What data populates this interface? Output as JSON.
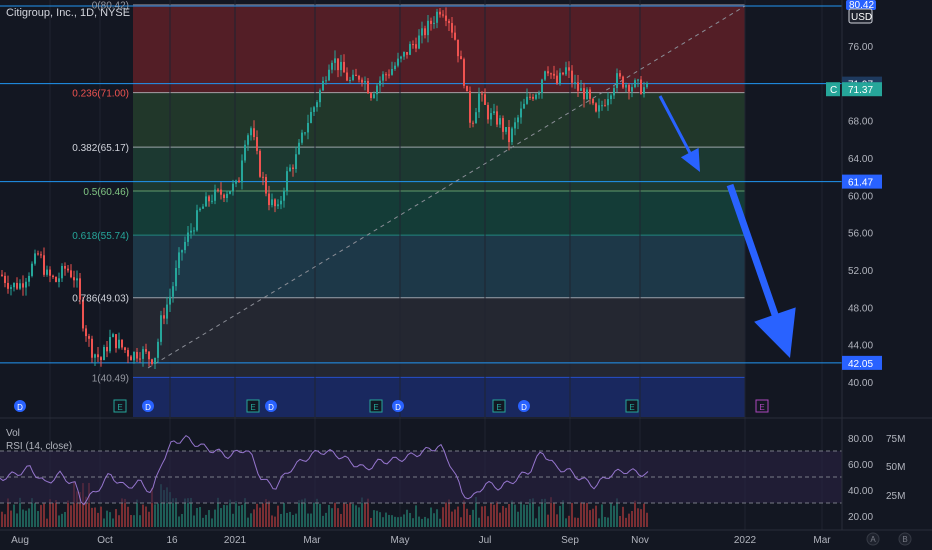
{
  "header": {
    "title": "Citigroup, Inc., 1D, NYSE"
  },
  "price_axis": {
    "currency": "USD",
    "ticks": [
      "76.00",
      "72.00",
      "68.00",
      "64.00",
      "60.00",
      "56.00",
      "52.00",
      "48.00",
      "44.00",
      "40.00"
    ]
  },
  "price_tags": [
    {
      "label": "71.97",
      "value": 71.97,
      "color": "#1e3a5f"
    },
    {
      "label": "C",
      "value": 71.37,
      "color": "#26a69a"
    },
    {
      "label": "71.37",
      "value": 71.37,
      "color": "#26a69a"
    },
    {
      "label": "61.47",
      "value": 61.47,
      "color": "#2962ff"
    },
    {
      "label": "42.05",
      "value": 42.05,
      "color": "#2962ff"
    }
  ],
  "top_tag": "80.42",
  "indicators": {
    "vol_label": "Vol",
    "rsi_label": "RSI (14, close)",
    "rsi_ticks": [
      "80.00",
      "60.00",
      "40.00",
      "20.00"
    ],
    "vol_ticks": [
      "75M",
      "50M",
      "25M"
    ]
  },
  "time_axis": {
    "labels": [
      "Aug",
      "Oct",
      "16",
      "2021",
      "Mar",
      "May",
      "Jul",
      "Sep",
      "Nov",
      "2022",
      "Mar"
    ],
    "bottom_icons": [
      "A",
      "B"
    ]
  },
  "event_markers": [
    {
      "type": "D",
      "x": 20
    },
    {
      "type": "E",
      "x": 120
    },
    {
      "type": "D",
      "x": 148
    },
    {
      "type": "E",
      "x": 253
    },
    {
      "type": "D",
      "x": 271
    },
    {
      "type": "E",
      "x": 376
    },
    {
      "type": "D",
      "x": 398
    },
    {
      "type": "E",
      "x": 499
    },
    {
      "type": "D",
      "x": 524
    },
    {
      "type": "E",
      "x": 632
    },
    {
      "type": "E",
      "x": 762
    }
  ],
  "chart_data": {
    "type": "candlestick",
    "title": "Citigroup, Inc., 1D, NYSE",
    "ylim": [
      38.5,
      81
    ],
    "x_labels": [
      "Aug",
      "Oct",
      "16",
      "2021",
      "Mar",
      "May",
      "Jul",
      "Sep",
      "Nov",
      "2022",
      "Mar"
    ],
    "fib_levels": [
      {
        "label": "0(80.42)",
        "value": 80.42
      },
      {
        "label": "0.236(71.00)",
        "value": 71.0
      },
      {
        "label": "0.382(65.17)",
        "value": 65.17
      },
      {
        "label": "0.5(60.46)",
        "value": 60.46
      },
      {
        "label": "0.618(55.74)",
        "value": 55.74
      },
      {
        "label": "0.786(49.03)",
        "value": 49.03
      },
      {
        "label": "1(40.49)",
        "value": 40.49
      }
    ],
    "horizontal_lines": [
      71.97,
      61.47,
      42.05
    ],
    "last_price": 71.37,
    "price_path": [
      [
        0,
        51.5
      ],
      [
        10,
        50.3
      ],
      [
        20,
        50.5
      ],
      [
        30,
        52.2
      ],
      [
        38,
        53.8
      ],
      [
        45,
        51.5
      ],
      [
        55,
        50.8
      ],
      [
        65,
        52.3
      ],
      [
        75,
        51.0
      ],
      [
        82,
        46.5
      ],
      [
        90,
        43.5
      ],
      [
        100,
        42.4
      ],
      [
        110,
        44.8
      ],
      [
        120,
        43.8
      ],
      [
        130,
        42.9
      ],
      [
        140,
        43.3
      ],
      [
        150,
        42.5
      ],
      [
        155,
        43.0
      ],
      [
        160,
        46.5
      ],
      [
        170,
        49.5
      ],
      [
        180,
        54.0
      ],
      [
        190,
        56.3
      ],
      [
        200,
        58.5
      ],
      [
        210,
        59.8
      ],
      [
        220,
        60.2
      ],
      [
        230,
        60.8
      ],
      [
        237,
        61.0
      ],
      [
        243,
        66.0
      ],
      [
        250,
        67.2
      ],
      [
        258,
        63.0
      ],
      [
        268,
        59.5
      ],
      [
        277,
        58.3
      ],
      [
        285,
        62.0
      ],
      [
        295,
        64.0
      ],
      [
        305,
        67.5
      ],
      [
        315,
        70.0
      ],
      [
        322,
        72.0
      ],
      [
        330,
        75.0
      ],
      [
        340,
        73.5
      ],
      [
        350,
        72.0
      ],
      [
        360,
        73.0
      ],
      [
        370,
        71.0
      ],
      [
        380,
        72.5
      ],
      [
        390,
        73.5
      ],
      [
        400,
        74.5
      ],
      [
        410,
        76.0
      ],
      [
        420,
        77.0
      ],
      [
        430,
        78.5
      ],
      [
        440,
        80.2
      ],
      [
        447,
        79.2
      ],
      [
        455,
        76.5
      ],
      [
        463,
        72.5
      ],
      [
        470,
        67.5
      ],
      [
        478,
        70.8
      ],
      [
        488,
        68.5
      ],
      [
        498,
        68.0
      ],
      [
        508,
        66.0
      ],
      [
        518,
        68.5
      ],
      [
        528,
        70.5
      ],
      [
        538,
        71.5
      ],
      [
        545,
        74.2
      ],
      [
        555,
        71.8
      ],
      [
        565,
        73.5
      ],
      [
        575,
        71.5
      ],
      [
        585,
        70.8
      ],
      [
        595,
        68.5
      ],
      [
        605,
        70.5
      ],
      [
        615,
        72.5
      ],
      [
        625,
        72.0
      ],
      [
        632,
        71.8
      ],
      [
        642,
        71.5
      ],
      [
        648,
        71.3
      ]
    ],
    "rsi_path": [
      [
        0,
        49
      ],
      [
        15,
        52
      ],
      [
        30,
        57
      ],
      [
        45,
        45
      ],
      [
        60,
        52
      ],
      [
        75,
        44
      ],
      [
        82,
        30
      ],
      [
        95,
        38
      ],
      [
        110,
        52
      ],
      [
        125,
        42
      ],
      [
        140,
        46
      ],
      [
        152,
        38
      ],
      [
        162,
        62
      ],
      [
        172,
        76
      ],
      [
        185,
        80
      ],
      [
        200,
        74
      ],
      [
        215,
        70
      ],
      [
        230,
        66
      ],
      [
        245,
        72
      ],
      [
        252,
        65
      ],
      [
        262,
        48
      ],
      [
        275,
        42
      ],
      [
        290,
        56
      ],
      [
        305,
        64
      ],
      [
        320,
        70
      ],
      [
        335,
        68
      ],
      [
        350,
        62
      ],
      [
        365,
        56
      ],
      [
        380,
        62
      ],
      [
        395,
        63
      ],
      [
        410,
        66
      ],
      [
        425,
        70
      ],
      [
        440,
        74
      ],
      [
        452,
        58
      ],
      [
        462,
        38
      ],
      [
        472,
        33
      ],
      [
        485,
        45
      ],
      [
        500,
        42
      ],
      [
        515,
        48
      ],
      [
        530,
        55
      ],
      [
        542,
        70
      ],
      [
        555,
        58
      ],
      [
        570,
        54
      ],
      [
        585,
        47
      ],
      [
        595,
        43
      ],
      [
        610,
        52
      ],
      [
        625,
        55
      ],
      [
        640,
        53
      ],
      [
        648,
        52
      ]
    ],
    "projection_arrows": [
      {
        "from": [
          660,
          96
        ],
        "to": [
          700,
          172
        ]
      },
      {
        "from": [
          730,
          185
        ],
        "to": [
          790,
          358
        ]
      }
    ]
  }
}
